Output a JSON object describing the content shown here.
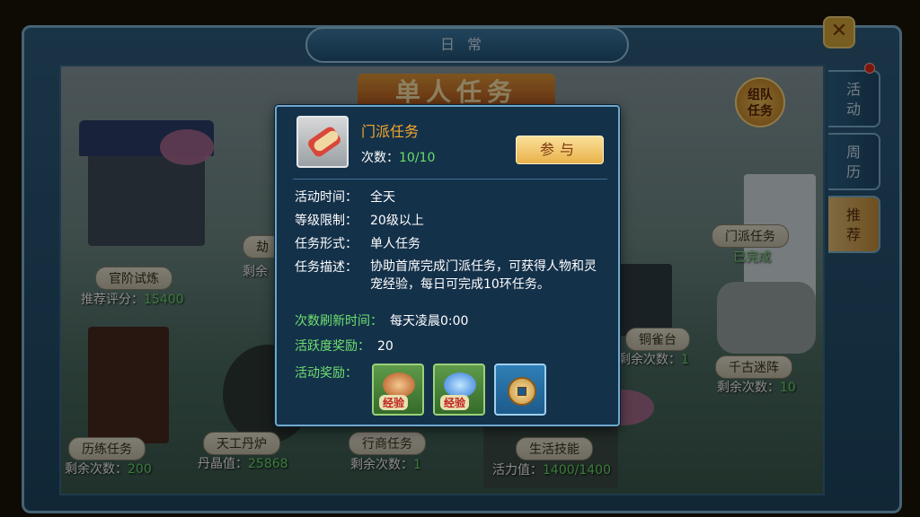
{
  "window": {
    "title": "日常",
    "close_symbol": "✕"
  },
  "scene": {
    "banner": "单人任务",
    "team_button": "组队\n任务",
    "labels": [
      {
        "name": "官阶试炼",
        "sub_key": "推荐评分：",
        "sub_val": "15400"
      },
      {
        "name": "劫",
        "sub_key": "剩余",
        "sub_val": ""
      },
      {
        "name": "历练任务",
        "sub_key": "剩余次数：",
        "sub_val": "200"
      },
      {
        "name": "天工丹炉",
        "sub_key": "丹晶值：",
        "sub_val": "25868"
      },
      {
        "name": "行商任务",
        "sub_key": "剩余次数：",
        "sub_val": "1"
      },
      {
        "name": "生活技能",
        "sub_key": "活力值：",
        "sub_val": "1400/1400"
      },
      {
        "name": "铜雀台",
        "sub_key": "剩余次数：",
        "sub_val": "1"
      },
      {
        "name": "千古迷阵",
        "sub_key": "剩余次数：",
        "sub_val": "10"
      },
      {
        "name": "门派任务",
        "status": "已完成"
      }
    ]
  },
  "tabs": [
    {
      "label": "活动",
      "active": false
    },
    {
      "label": "周历",
      "active": false
    },
    {
      "label": "推荐",
      "active": true
    }
  ],
  "popup": {
    "task_name": "门派任务",
    "count_label": "次数：",
    "count_value": "10/10",
    "join_label": "参与",
    "rows": [
      {
        "key": "活动时间：",
        "value": "全天"
      },
      {
        "key": "等级限制：",
        "value": "20级以上"
      },
      {
        "key": "任务形式：",
        "value": "单人任务"
      }
    ],
    "desc_key": "任务描述：",
    "desc_value": "协助首席完成门派任务，可获得人物和灵宠经验，每日可完成10环任务。",
    "refresh_key": "次数刷新时间：",
    "refresh_value": "每天凌晨0:00",
    "activity_key": "活跃度奖励：",
    "activity_value": "20",
    "reward_key": "活动奖励：",
    "rewards": [
      {
        "icon": "person-exp-icon",
        "tag": "经验"
      },
      {
        "icon": "pet-exp-icon",
        "tag": "经验"
      },
      {
        "icon": "coin-icon",
        "tag": ""
      }
    ]
  }
}
